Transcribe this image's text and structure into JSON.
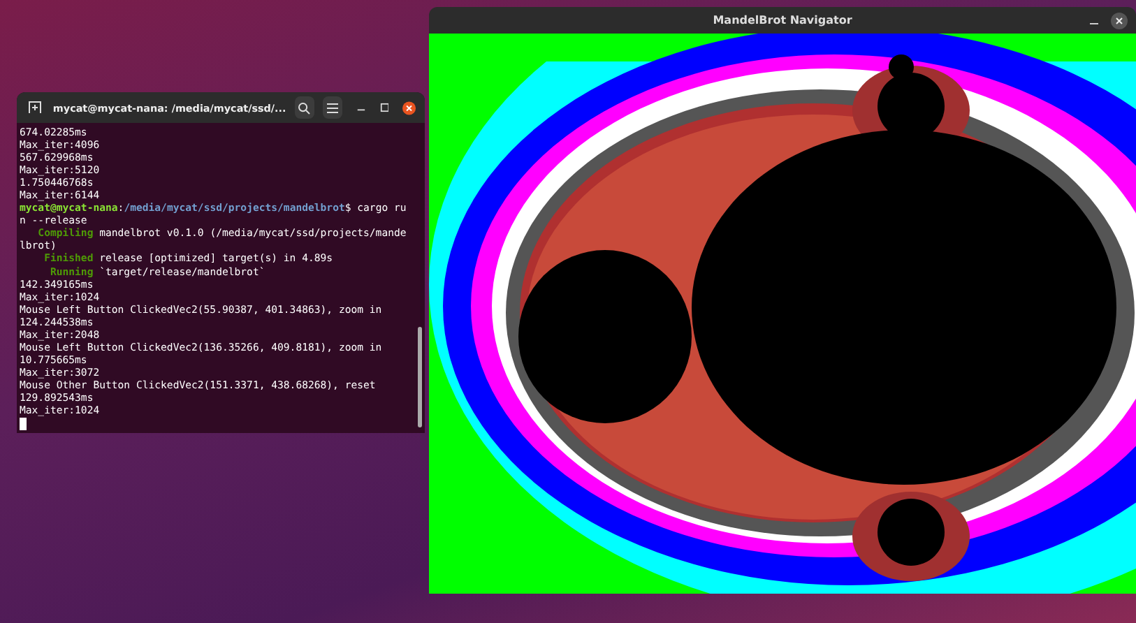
{
  "terminal": {
    "title": "mycat@mycat-nana: /media/mycat/ssd/...",
    "lines": [
      [
        {
          "kind": "plain",
          "text": "674.02285ms"
        }
      ],
      [
        {
          "kind": "plain",
          "text": "Max_iter:4096"
        }
      ],
      [
        {
          "kind": "plain",
          "text": "567.629968ms"
        }
      ],
      [
        {
          "kind": "plain",
          "text": "Max_iter:5120"
        }
      ],
      [
        {
          "kind": "plain",
          "text": "1.750446768s"
        }
      ],
      [
        {
          "kind": "plain",
          "text": "Max_iter:6144"
        }
      ],
      [
        {
          "kind": "user",
          "text": "mycat@mycat-nana"
        },
        {
          "kind": "plain",
          "text": ":"
        },
        {
          "kind": "path",
          "text": "/media/mycat/ssd/projects/mandelbrot"
        },
        {
          "kind": "plain",
          "text": "$ cargo ru"
        }
      ],
      [
        {
          "kind": "plain",
          "text": "n --release"
        }
      ],
      [
        {
          "kind": "status",
          "text": "   Compiling"
        },
        {
          "kind": "plain",
          "text": " mandelbrot v0.1.0 (/media/mycat/ssd/projects/mande"
        }
      ],
      [
        {
          "kind": "plain",
          "text": "lbrot)"
        }
      ],
      [
        {
          "kind": "status",
          "text": "    Finished"
        },
        {
          "kind": "plain",
          "text": " release [optimized] target(s) in 4.89s"
        }
      ],
      [
        {
          "kind": "status",
          "text": "     Running"
        },
        {
          "kind": "plain",
          "text": " `target/release/mandelbrot`"
        }
      ],
      [
        {
          "kind": "plain",
          "text": "142.349165ms"
        }
      ],
      [
        {
          "kind": "plain",
          "text": "Max_iter:1024"
        }
      ],
      [
        {
          "kind": "plain",
          "text": "Mouse Left Button ClickedVec2(55.90387, 401.34863), zoom in"
        }
      ],
      [
        {
          "kind": "plain",
          "text": "124.244538ms"
        }
      ],
      [
        {
          "kind": "plain",
          "text": "Max_iter:2048"
        }
      ],
      [
        {
          "kind": "plain",
          "text": "Mouse Left Button ClickedVec2(136.35266, 409.8181), zoom in"
        }
      ],
      [
        {
          "kind": "plain",
          "text": "10.775665ms"
        }
      ],
      [
        {
          "kind": "plain",
          "text": "Max_iter:3072"
        }
      ],
      [
        {
          "kind": "plain",
          "text": "Mouse Other Button ClickedVec2(151.3371, 438.68268), reset"
        }
      ],
      [
        {
          "kind": "plain",
          "text": "129.892543ms"
        }
      ],
      [
        {
          "kind": "plain",
          "text": "Max_iter:1024"
        }
      ]
    ]
  },
  "navigator": {
    "title": "MandelBrot Navigator"
  }
}
